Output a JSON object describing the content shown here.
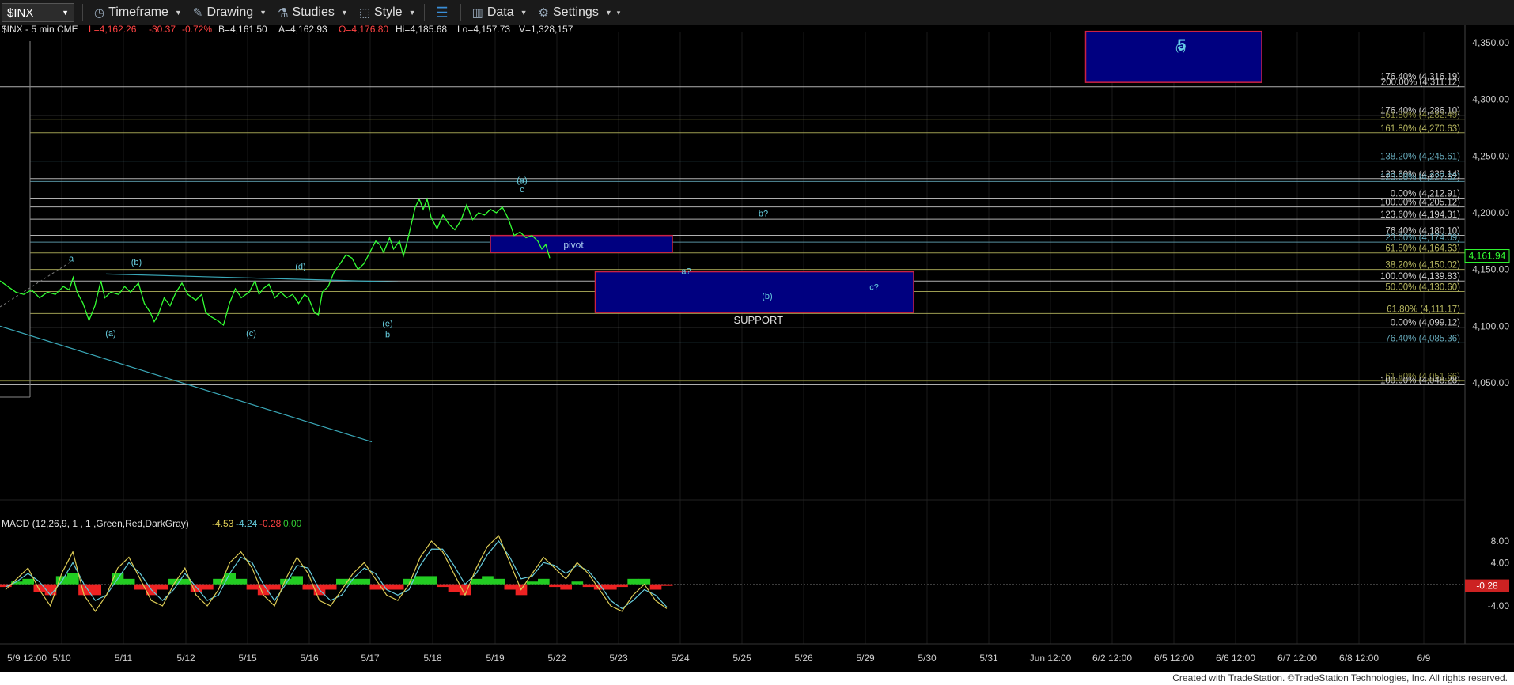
{
  "toolbar": {
    "symbol": "$INX",
    "timeframe": "Timeframe",
    "drawing": "Drawing",
    "studies": "Studies",
    "style": "Style",
    "data": "Data",
    "settings": "Settings"
  },
  "quote": {
    "symbol_info": "$INX - 5 min  CME",
    "last": "L=4,162.26",
    "change": "-30.37",
    "change_pct": "-0.72%",
    "bid": "B=4,161.50",
    "ask": "A=4,162.93",
    "open": "O=4,176.80",
    "high": "Hi=4,185.68",
    "low": "Lo=4,157.73",
    "volume": "V=1,328,157"
  },
  "colors": {
    "price": "#33ff33",
    "down": "#ff3333",
    "wave_label": "#66ccdd",
    "box_fill": "#000080",
    "box_border": "#cc2244"
  },
  "chart_data": [
    {
      "type": "line",
      "title": "$INX - 5 min",
      "ylim": [
        4000,
        4370
      ],
      "y_ticks": [
        "4,350.00",
        "4,300.00",
        "4,250.00",
        "4,200.00",
        "4,150.00",
        "4,100.00",
        "4,050.00"
      ],
      "x_ticks": [
        "5/9 12:00",
        "5/10",
        "5/11",
        "5/12",
        "5/15",
        "5/16",
        "5/17",
        "5/18",
        "5/19",
        "5/22",
        "5/23",
        "5/24",
        "5/25",
        "5/26",
        "5/29",
        "5/30",
        "5/31",
        "Jun 12:00",
        "6/2 12:00",
        "6/5 12:00",
        "6/6 12:00",
        "6/7 12:00",
        "6/8 12:00",
        "6/9"
      ],
      "last_price_label": "4,161.94",
      "series": [
        {
          "points": [
            [
              0,
              4140
            ],
            [
              4,
              4135
            ],
            [
              8,
              4130
            ],
            [
              12,
              4128
            ],
            [
              16,
              4132
            ],
            [
              20,
              4125
            ],
            [
              24,
              4130
            ],
            [
              28,
              4128
            ],
            [
              32,
              4135
            ],
            [
              35,
              4132
            ],
            [
              37,
              4143
            ],
            [
              39,
              4130
            ],
            [
              42,
              4120
            ],
            [
              45,
              4105
            ],
            [
              48,
              4118
            ],
            [
              51,
              4140
            ],
            [
              53,
              4125
            ],
            [
              56,
              4130
            ],
            [
              60,
              4128
            ],
            [
              63,
              4135
            ],
            [
              66,
              4130
            ],
            [
              70,
              4138
            ],
            [
              73,
              4120
            ],
            [
              76,
              4112
            ],
            [
              78,
              4104
            ],
            [
              80,
              4110
            ],
            [
              83,
              4125
            ],
            [
              86,
              4118
            ],
            [
              89,
              4130
            ],
            [
              92,
              4138
            ],
            [
              95,
              4128
            ],
            [
              99,
              4123
            ],
            [
              102,
              4128
            ],
            [
              104,
              4112
            ],
            [
              107,
              4108
            ],
            [
              110,
              4105
            ],
            [
              113,
              4101
            ],
            [
              116,
              4120
            ],
            [
              119,
              4133
            ],
            [
              122,
              4125
            ],
            [
              126,
              4130
            ],
            [
              129,
              4140
            ],
            [
              131,
              4128
            ],
            [
              133,
              4133
            ],
            [
              136,
              4137
            ],
            [
              139,
              4125
            ],
            [
              142,
              4130
            ],
            [
              145,
              4125
            ],
            [
              148,
              4128
            ],
            [
              151,
              4120
            ],
            [
              154,
              4128
            ],
            [
              156,
              4125
            ],
            [
              159,
              4112
            ],
            [
              161,
              4110
            ],
            [
              163,
              4130
            ],
            [
              166,
              4135
            ],
            [
              169,
              4148
            ],
            [
              172,
              4155
            ],
            [
              175,
              4163
            ],
            [
              178,
              4160
            ],
            [
              181,
              4150
            ],
            [
              184,
              4155
            ],
            [
              187,
              4165
            ],
            [
              190,
              4175
            ],
            [
              192,
              4172
            ],
            [
              194,
              4165
            ],
            [
              197,
              4178
            ],
            [
              199,
              4168
            ],
            [
              202,
              4175
            ],
            [
              204,
              4162
            ],
            [
              206,
              4175
            ],
            [
              208,
              4190
            ],
            [
              210,
              4205
            ],
            [
              212,
              4212
            ],
            [
              214,
              4203
            ],
            [
              216,
              4212
            ],
            [
              218,
              4196
            ],
            [
              221,
              4186
            ],
            [
              224,
              4198
            ],
            [
              227,
              4190
            ],
            [
              230,
              4185
            ],
            [
              233,
              4193
            ],
            [
              236,
              4207
            ],
            [
              239,
              4194
            ],
            [
              242,
              4200
            ],
            [
              245,
              4198
            ],
            [
              248,
              4203
            ],
            [
              251,
              4200
            ],
            [
              254,
              4205
            ],
            [
              257,
              4195
            ],
            [
              260,
              4180
            ],
            [
              263,
              4183
            ],
            [
              266,
              4178
            ],
            [
              269,
              4180
            ],
            [
              272,
              4175
            ],
            [
              274,
              4168
            ],
            [
              276,
              4172
            ],
            [
              278,
              4160
            ]
          ]
        }
      ],
      "fib_levels": [
        {
          "label": "176.40% (4,316.19)",
          "value": 4316.19,
          "color": "#cfcfcf"
        },
        {
          "label": "200.00% (4,311.12)",
          "value": 4311.12,
          "color": "#cfcfcf"
        },
        {
          "label": "176.40% (4,286.10)",
          "value": 4286.1,
          "color": "#cfcfcf"
        },
        {
          "label": "161.80% (4,282.49)",
          "value": 4282.49,
          "color": "#8a8a40"
        },
        {
          "label": "161.80% (4,270.63)",
          "value": 4270.63,
          "color": "#b8b860"
        },
        {
          "label": "138.20% (4,245.61)",
          "value": 4245.61,
          "color": "#66aabb"
        },
        {
          "label": "123.60% (4,230.14)",
          "value": 4230.14,
          "color": "#cfcfcf"
        },
        {
          "label": "123.60% (4,227.62)",
          "value": 4227.62,
          "color": "#66aabb"
        },
        {
          "label": "0.00% (4,212.91)",
          "value": 4212.91,
          "color": "#cfcfcf"
        },
        {
          "label": "100.00% (4,205.12)",
          "value": 4205.12,
          "color": "#cfcfcf"
        },
        {
          "label": "123.60% (4,194.31)",
          "value": 4194.31,
          "color": "#cfcfcf"
        },
        {
          "label": "76.40% (4,180.10)",
          "value": 4180.1,
          "color": "#cfcfcf"
        },
        {
          "label": "23.60% (4,174.09)",
          "value": 4174.09,
          "color": "#66aabb"
        },
        {
          "label": "61.80% (4,164.63)",
          "value": 4164.63,
          "color": "#b8b860"
        },
        {
          "label": "38.20% (4,150.02)",
          "value": 4150.02,
          "color": "#b8b860"
        },
        {
          "label": "100.00% (4,139.83)",
          "value": 4139.83,
          "color": "#cfcfcf"
        },
        {
          "label": "50.00% (4,130.60)",
          "value": 4130.6,
          "color": "#b8b860"
        },
        {
          "label": "61.80% (4,111.17)",
          "value": 4111.17,
          "color": "#b8b860"
        },
        {
          "label": "0.00% (4,099.12)",
          "value": 4099.12,
          "color": "#cfcfcf"
        },
        {
          "label": "76.40% (4,085.36)",
          "value": 4085.36,
          "color": "#66aabb"
        },
        {
          "label": "61.80% (4,051.66)",
          "value": 4051.66,
          "color": "#8a8a40"
        },
        {
          "label": "100.00% (4,048.28)",
          "value": 4048.28,
          "color": "#cfcfcf"
        }
      ],
      "wave_labels": [
        {
          "text": "a",
          "x": 36,
          "y": 4157
        },
        {
          "text": "(b)",
          "x": 69,
          "y": 4154
        },
        {
          "text": "(d)",
          "x": 152,
          "y": 4150
        },
        {
          "text": "(a)",
          "x": 56,
          "y": 4091
        },
        {
          "text": "(c)",
          "x": 127,
          "y": 4091
        },
        {
          "text": "(e)",
          "x": 196,
          "y": 4100
        },
        {
          "text": "b",
          "x": 196,
          "y": 4090
        },
        {
          "text": "(a)",
          "x": 264,
          "y": 4226
        },
        {
          "text": "c",
          "x": 264,
          "y": 4218
        },
        {
          "text": "b?",
          "x": 386,
          "y": 4197
        },
        {
          "text": "a?",
          "x": 347,
          "y": 4146
        },
        {
          "text": "c?",
          "x": 442,
          "y": 4132
        },
        {
          "text": "(b)",
          "x": 388,
          "y": 4124
        },
        {
          "text": "(c)",
          "x": 597,
          "y": 4343
        }
      ],
      "boxes": [
        {
          "x0": 248,
          "x1": 340,
          "y0": 4165,
          "y1": 4180,
          "label": "pivot"
        },
        {
          "x0": 301,
          "x1": 462,
          "y0": 4112,
          "y1": 4148,
          "label": "SUPPORT"
        },
        {
          "x0": 549,
          "x1": 638,
          "y0": 4315,
          "y1": 4360,
          "label": "5"
        }
      ]
    },
    {
      "type": "line",
      "title": "MACD (12,26,9, 1 , 1 ,Green,Red,DarkGray)",
      "legend_values": [
        "-4.53",
        "-4.24",
        "-0.28",
        "0.00"
      ],
      "y_ticks": [
        "8.00",
        "4.00",
        "-4.00"
      ],
      "last_value_label": "-0.28",
      "ylim": [
        -6,
        10
      ],
      "series": [
        {
          "name": "MACD",
          "values": [
            -1,
            1,
            3,
            -1,
            -4,
            2,
            6,
            -2,
            -5,
            -2,
            3,
            5,
            1,
            -3,
            -4,
            0,
            3,
            -2,
            -4,
            -1,
            4,
            6,
            3,
            -2,
            -4,
            1,
            5,
            2,
            -3,
            -4,
            -1,
            2,
            4,
            1,
            -2,
            -3,
            0,
            5,
            8,
            6,
            2,
            -2,
            3,
            7,
            9,
            4,
            -1,
            2,
            5,
            3,
            1,
            4,
            2,
            -1,
            -4,
            -5,
            -2,
            0,
            -3,
            -4.5
          ]
        },
        {
          "name": "Avg",
          "values": [
            -0.5,
            0.5,
            2,
            0.5,
            -2,
            0.5,
            4,
            0,
            -3,
            -2,
            1,
            4,
            2,
            -1,
            -3,
            -1,
            2,
            -0.5,
            -3,
            -2,
            2,
            5,
            4,
            0,
            -3,
            0,
            3.5,
            3,
            -1,
            -3,
            -2,
            1,
            3,
            2,
            -1,
            -2,
            -1,
            3.5,
            6.5,
            6.5,
            3.5,
            0,
            2,
            5.5,
            8,
            5,
            1,
            1.5,
            4,
            3.5,
            2,
            3.5,
            2.5,
            0,
            -3,
            -4.5,
            -3,
            -1,
            -2,
            -4.2
          ]
        },
        {
          "name": "Diff",
          "values": [
            -0.5,
            0.5,
            1,
            -1.5,
            -2,
            1.5,
            2,
            -2,
            -2,
            0,
            2,
            1,
            -1,
            -2,
            -1,
            1,
            1,
            -1.5,
            -1,
            1,
            2,
            1,
            -1,
            -2,
            -1,
            1,
            1.5,
            -1,
            -2,
            -1,
            1,
            1,
            1,
            -1,
            -1,
            -1,
            1,
            1.5,
            1.5,
            -0.5,
            -1.5,
            -2,
            1,
            1.5,
            1,
            -1,
            -2,
            0.5,
            1,
            -0.5,
            -1,
            0.5,
            -0.5,
            -1,
            -1,
            -0.5,
            1,
            1,
            -1,
            -0.3
          ]
        }
      ]
    }
  ],
  "footer": "Created with TradeStation. ©TradeStation Technologies, Inc. All rights reserved."
}
